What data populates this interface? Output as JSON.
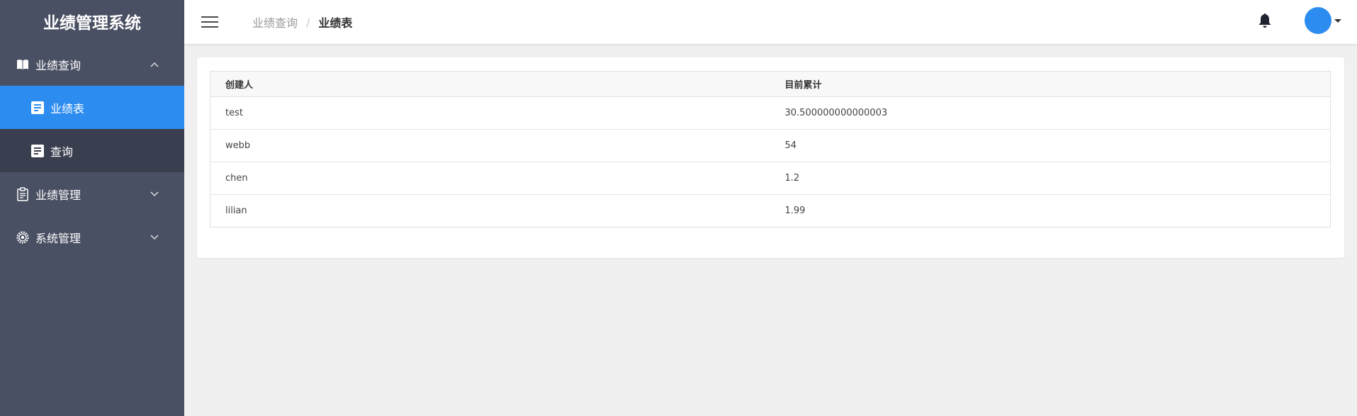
{
  "app": {
    "title": "业绩管理系统"
  },
  "sidebar": {
    "groups": [
      {
        "label": "业绩查询",
        "icon": "book-icon",
        "expanded": true,
        "items": [
          {
            "label": "业绩表",
            "icon": "document-icon",
            "active": true
          },
          {
            "label": "查询",
            "icon": "document-icon",
            "active": false
          }
        ]
      },
      {
        "label": "业绩管理",
        "icon": "clipboard-icon",
        "expanded": false
      },
      {
        "label": "系统管理",
        "icon": "gear-icon",
        "expanded": false
      }
    ]
  },
  "header": {
    "breadcrumb": {
      "parent": "业绩查询",
      "separator": "/",
      "current": "业绩表"
    }
  },
  "table": {
    "columns": [
      "创建人",
      "目前累计"
    ],
    "rows": [
      [
        "test",
        "30.500000000000003"
      ],
      [
        "webb",
        "54"
      ],
      [
        "chen",
        "1.2"
      ],
      [
        "lilian",
        "1.99"
      ]
    ]
  },
  "colors": {
    "sidebar": "#4a5063",
    "submenu": "#3a3f50",
    "accent": "#2d8cf0"
  }
}
